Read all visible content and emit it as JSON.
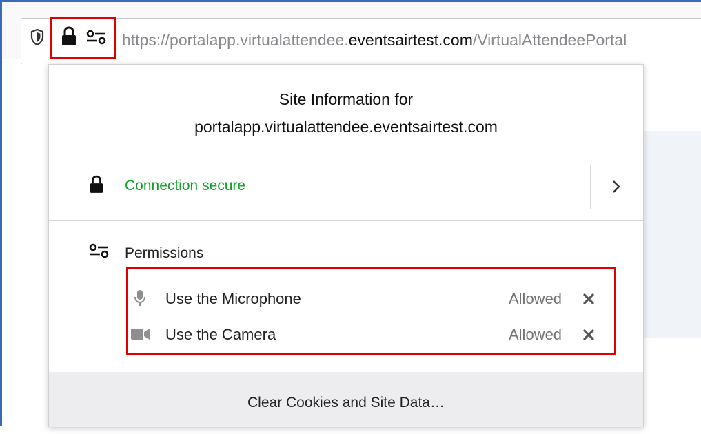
{
  "urlbar": {
    "url_prefix": "https://portalapp.virtualattendee.",
    "url_domain": "eventsairtest.com",
    "url_suffix": "/VirtualAttendeePortal",
    "icons": [
      "shield-icon",
      "lock-icon",
      "permissions-icon"
    ]
  },
  "panel": {
    "title_line1": "Site Information for",
    "title_line2": "portalapp.virtualattendee.eventsairtest.com",
    "connection": {
      "label": "Connection secure",
      "icon": "lock-icon",
      "arrow_icon": "chevron-right-icon"
    },
    "permissions": {
      "heading": "Permissions",
      "icon": "permissions-icon",
      "items": [
        {
          "label": "Use the Microphone",
          "status": "Allowed",
          "icon": "microphone-icon"
        },
        {
          "label": "Use the Camera",
          "status": "Allowed",
          "icon": "camera-icon"
        }
      ]
    },
    "footer": {
      "clear_button": "Clear Cookies and Site Data…"
    }
  },
  "colors": {
    "secure_green": "#12a128",
    "highlight_red": "#e00000",
    "window_frame": "#3b6bb5"
  }
}
